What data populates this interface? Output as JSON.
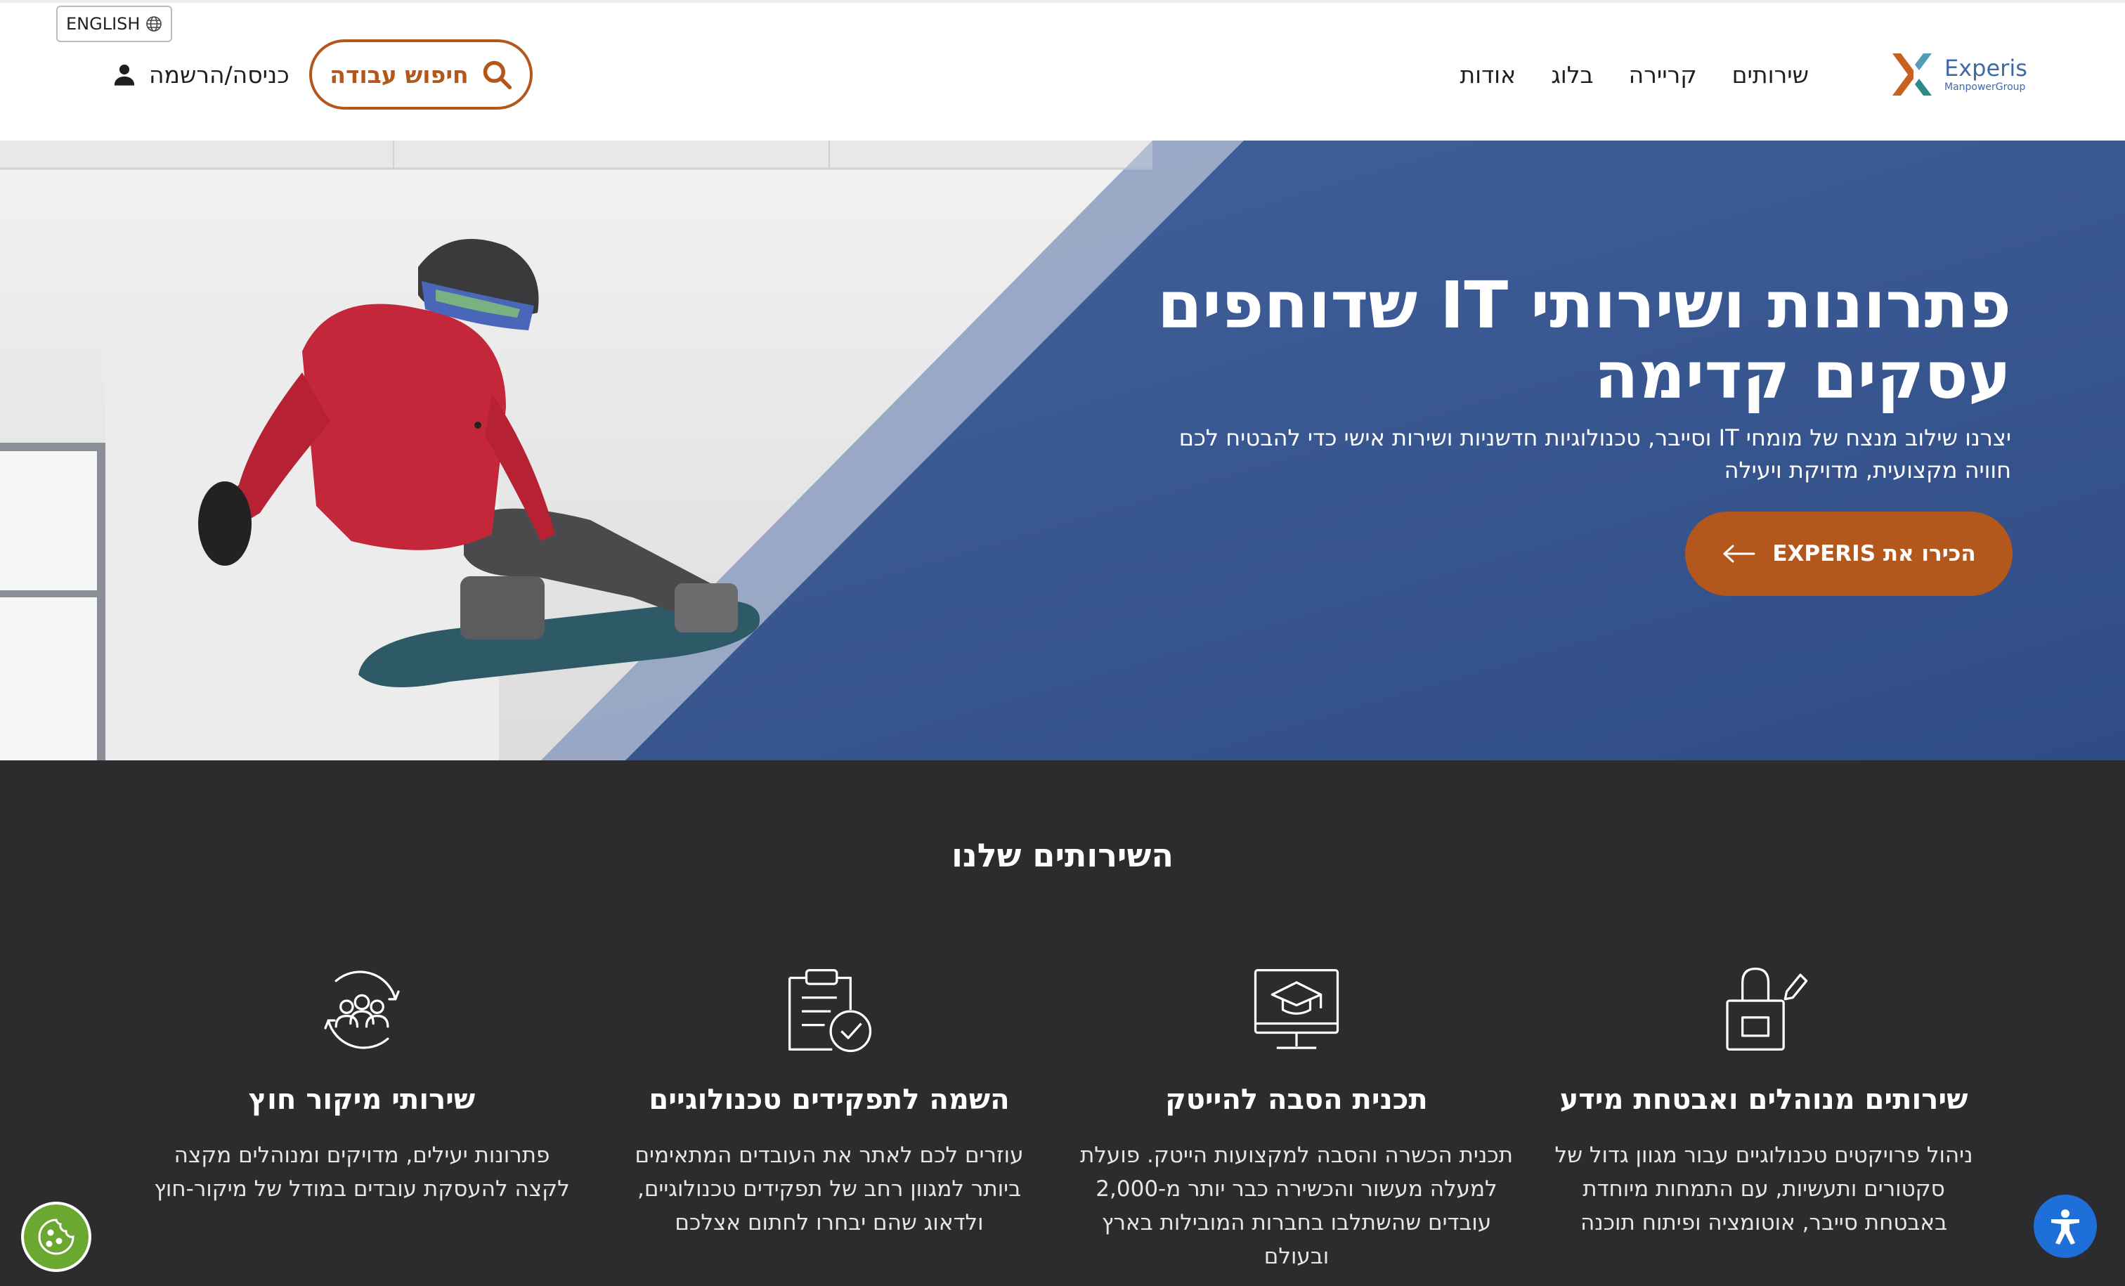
{
  "header": {
    "language_toggle": "ENGLISH",
    "login_label": "כניסה/הרשמה",
    "job_search_label": "חיפוש עבודה",
    "nav": [
      "שירותים",
      "קריירה",
      "בלוג",
      "אודות"
    ],
    "logo": {
      "name": "Experis",
      "sub": "ManpowerGroup"
    }
  },
  "hero": {
    "title": "פתרונות ושירותי IT שדוחפים עסקים קדימה",
    "text": "יצרנו שילוב מנצח של מומחי IT וסייבר, טכנולוגיות חדשניות ושירות אישי כדי להבטיח לכם חוויה מקצועית, מדויקת ויעילה",
    "cta_label": "הכירו את EXPERIS"
  },
  "services": {
    "title": "השירותים שלנו",
    "items": [
      {
        "title": "שירותים מנוהלים ואבטחת מידע",
        "desc": "ניהול פרויקטים טכנולוגיים עבור מגוון גדול של סקטורים ותעשיות, עם התמחות מיוחדת באבטחת סייבר, אוטומציה ופיתוח תוכנה",
        "icon": "lock-pen-icon"
      },
      {
        "title": "תכנית הסבה להייטק",
        "desc": "תכנית הכשרה והסבה למקצועות הייטק. פועלת למעלה מעשור והכשירה כבר יותר מ-2,000 עובדים שהשתלבו בחברות המובילות בארץ ובעולם",
        "icon": "graduation-monitor-icon"
      },
      {
        "title": "השמה לתפקידים טכנולוגיים",
        "desc": "עוזרים לכם לאתר את העובדים המתאימים ביותר למגוון רחב של תפקידים טכנולוגיים, ולדאוג שהם יבחרו לחתום אצלכם",
        "icon": "clipboard-check-icon"
      },
      {
        "title": "שירותי מיקור חוץ",
        "desc": "פתרונות יעילים, מדויקים ומנוהלים מקצה לקצה להעסקת עובדים במודל של מיקור-חוץ",
        "icon": "people-cycle-icon"
      }
    ]
  },
  "colors": {
    "accent_orange": "#b3571c",
    "hero_blue": "#3f5f99",
    "services_bg": "#2c2c2e",
    "logo_blue": "#3f6aa8",
    "cookie_green": "#6aa832",
    "accessibility_blue": "#1f6fd9"
  }
}
